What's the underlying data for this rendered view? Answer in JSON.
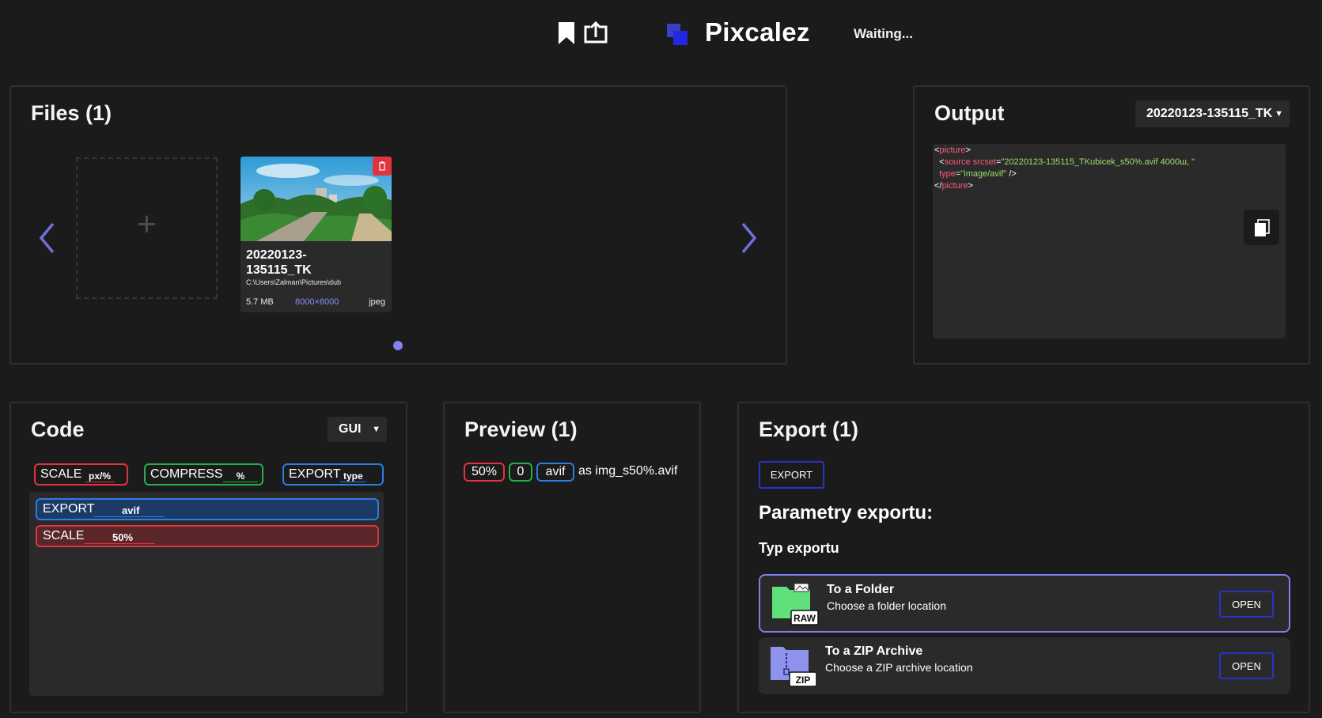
{
  "header": {
    "bookmark_icon": "bookmark-icon",
    "export_icon": "share-upload-icon",
    "app_name": "Pixcalez",
    "status": "Waiting..."
  },
  "files": {
    "title": "Files (1)",
    "add_symbol": "+",
    "prev_icon": "chevron-left-icon",
    "next_icon": "chevron-right-icon",
    "items": [
      {
        "name": "20220123-135115_TK",
        "name_line1": "20220123-",
        "name_line2": "135115_TK",
        "path": "C:\\Users\\Zalman\\Pictures\\dub",
        "size": "5.7 MB",
        "dimensions": "8000×6000",
        "type": "jpeg"
      }
    ],
    "pages": 1
  },
  "output": {
    "title": "Output",
    "selected_file": "20220123-135115_TK",
    "code": {
      "open_tag": "picture",
      "source_tag": "source",
      "srcset_attr": "srcset",
      "srcset_value": "\"20220123-135115_TKubicek_s50%.avif 4000ш, \"",
      "type_attr": "type",
      "type_value": "\"image/avif\"",
      "self_close": " />",
      "close_tag": "picture"
    }
  },
  "code": {
    "title": "Code",
    "mode": "GUI",
    "toolbox": [
      {
        "label": "SCALE",
        "sub": "px/%",
        "color": "#e1343e"
      },
      {
        "label": "COMPRESS",
        "sub": "%",
        "color": "#23b04c"
      },
      {
        "label": "EXPORT",
        "sub": "type",
        "color": "#2c7ce2"
      }
    ],
    "blocks": [
      {
        "label": "EXPORT",
        "value": "avif",
        "color": "#2c7ce2"
      },
      {
        "label": "SCALE",
        "value": "50%",
        "color": "#e1343e"
      }
    ]
  },
  "preview": {
    "title": "Preview (1)",
    "chips": [
      "50%",
      "0",
      "avif"
    ],
    "suffix": "as img_s50%.avif"
  },
  "export": {
    "title": "Export (1)",
    "button": "EXPORT",
    "params_title": "Parametry exportu:",
    "type_title": "Typ exportu",
    "options": [
      {
        "title": "To a Folder",
        "desc": "Choose a folder location",
        "badge": "RAW",
        "button": "OPEN",
        "icon": "folder-icon"
      },
      {
        "title": "To a ZIP Archive",
        "desc": "Choose a ZIP archive location",
        "badge": "ZIP",
        "button": "OPEN",
        "icon": "zip-archive-icon"
      }
    ]
  },
  "colors": {
    "background": "#1b1b1c",
    "panel": "#2a2a2b",
    "accent": "#7d80ea",
    "red": "#e1343e",
    "green": "#23b04c",
    "blue": "#2c7ce2"
  }
}
